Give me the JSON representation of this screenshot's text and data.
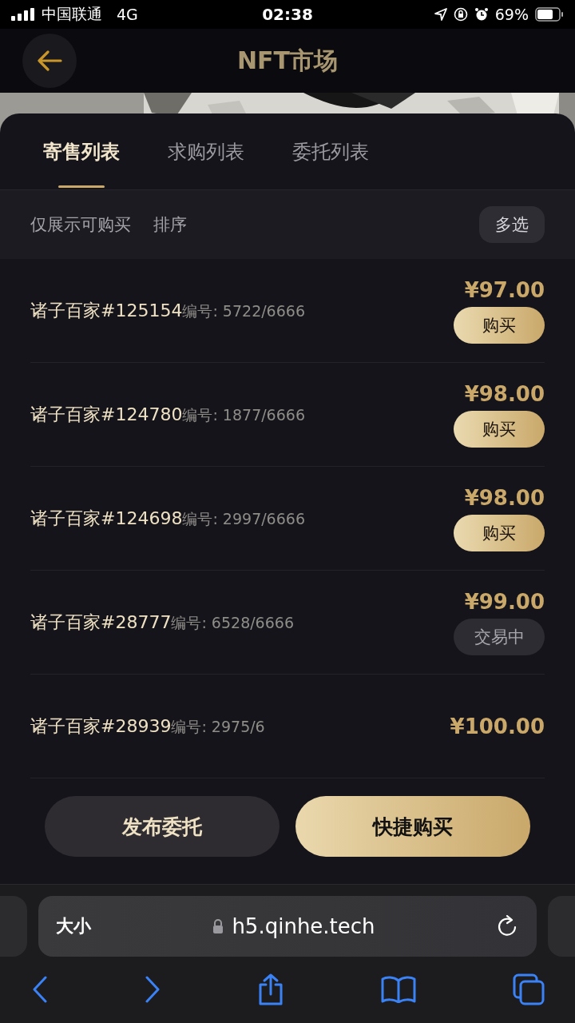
{
  "status_bar": {
    "carrier": "中国联通",
    "network": "4G",
    "time": "02:38",
    "battery": "69%"
  },
  "header": {
    "title": "NFT市场"
  },
  "tabs": [
    {
      "label": "寄售列表",
      "selected": true
    },
    {
      "label": "求购列表",
      "selected": false
    },
    {
      "label": "委托列表",
      "selected": false
    }
  ],
  "filters": {
    "only_buyable": "仅展示可购买",
    "sort": "排序",
    "multi_select": "多选"
  },
  "listings": [
    {
      "name": "诸子百家#125154",
      "serial": "编号: 5722/6666",
      "price": "¥97.00",
      "action": {
        "kind": "buy",
        "label": "购买"
      }
    },
    {
      "name": "诸子百家#124780",
      "serial": "编号: 1877/6666",
      "price": "¥98.00",
      "action": {
        "kind": "buy",
        "label": "购买"
      }
    },
    {
      "name": "诸子百家#124698",
      "serial": "编号: 2997/6666",
      "price": "¥98.00",
      "action": {
        "kind": "buy",
        "label": "购买"
      }
    },
    {
      "name": "诸子百家#28777",
      "serial": "编号: 6528/6666",
      "price": "¥99.00",
      "action": {
        "kind": "trading",
        "label": "交易中"
      }
    },
    {
      "name": "诸子百家#28939",
      "serial": "编号: 2975/6",
      "price": "¥100.00"
    }
  ],
  "bottom_actions": {
    "publish": "发布委托",
    "quick_buy": "快捷购买"
  },
  "browser": {
    "text_size": "大小",
    "url": "h5.qinhe.tech"
  }
}
